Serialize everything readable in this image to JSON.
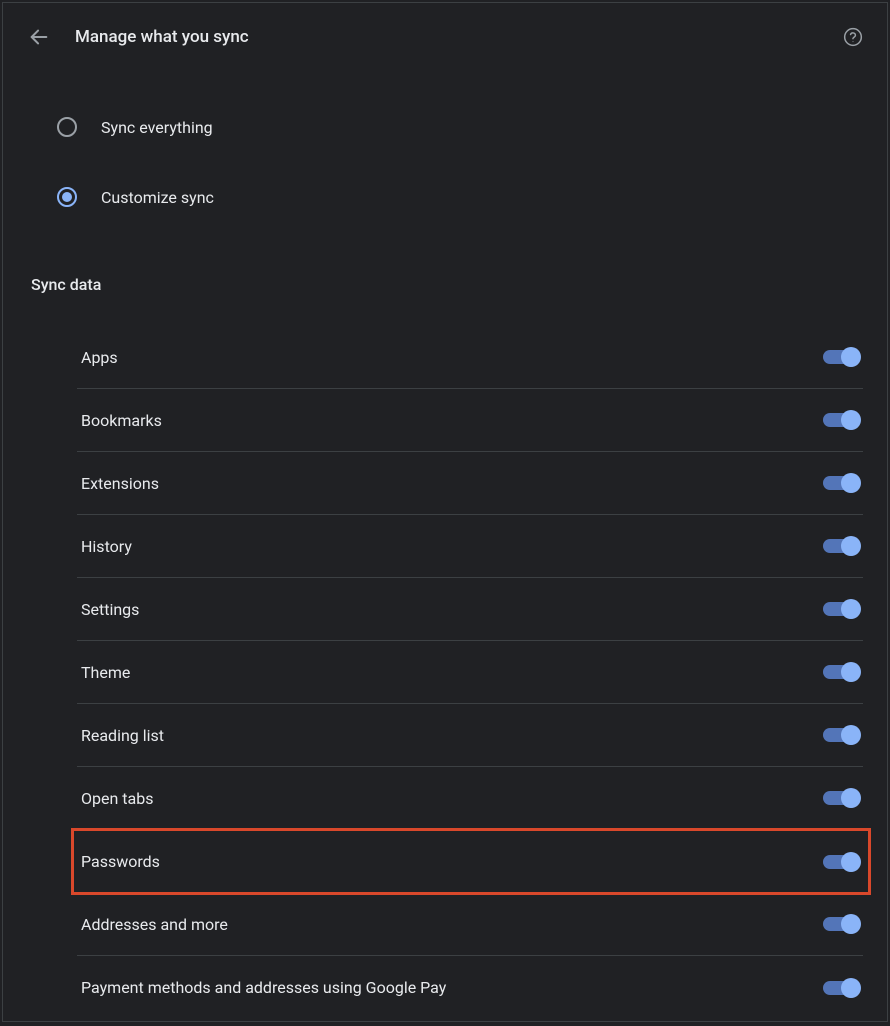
{
  "header": {
    "title": "Manage what you sync"
  },
  "radios": [
    {
      "label": "Sync everything",
      "selected": false
    },
    {
      "label": "Customize sync",
      "selected": true
    }
  ],
  "section_title": "Sync data",
  "toggles": [
    {
      "label": "Apps",
      "on": true,
      "highlighted": false
    },
    {
      "label": "Bookmarks",
      "on": true,
      "highlighted": false
    },
    {
      "label": "Extensions",
      "on": true,
      "highlighted": false
    },
    {
      "label": "History",
      "on": true,
      "highlighted": false
    },
    {
      "label": "Settings",
      "on": true,
      "highlighted": false
    },
    {
      "label": "Theme",
      "on": true,
      "highlighted": false
    },
    {
      "label": "Reading list",
      "on": true,
      "highlighted": false
    },
    {
      "label": "Open tabs",
      "on": true,
      "highlighted": false
    },
    {
      "label": "Passwords",
      "on": true,
      "highlighted": true
    },
    {
      "label": "Addresses and more",
      "on": true,
      "highlighted": false
    },
    {
      "label": "Payment methods and addresses using Google Pay",
      "on": true,
      "highlighted": false
    }
  ]
}
